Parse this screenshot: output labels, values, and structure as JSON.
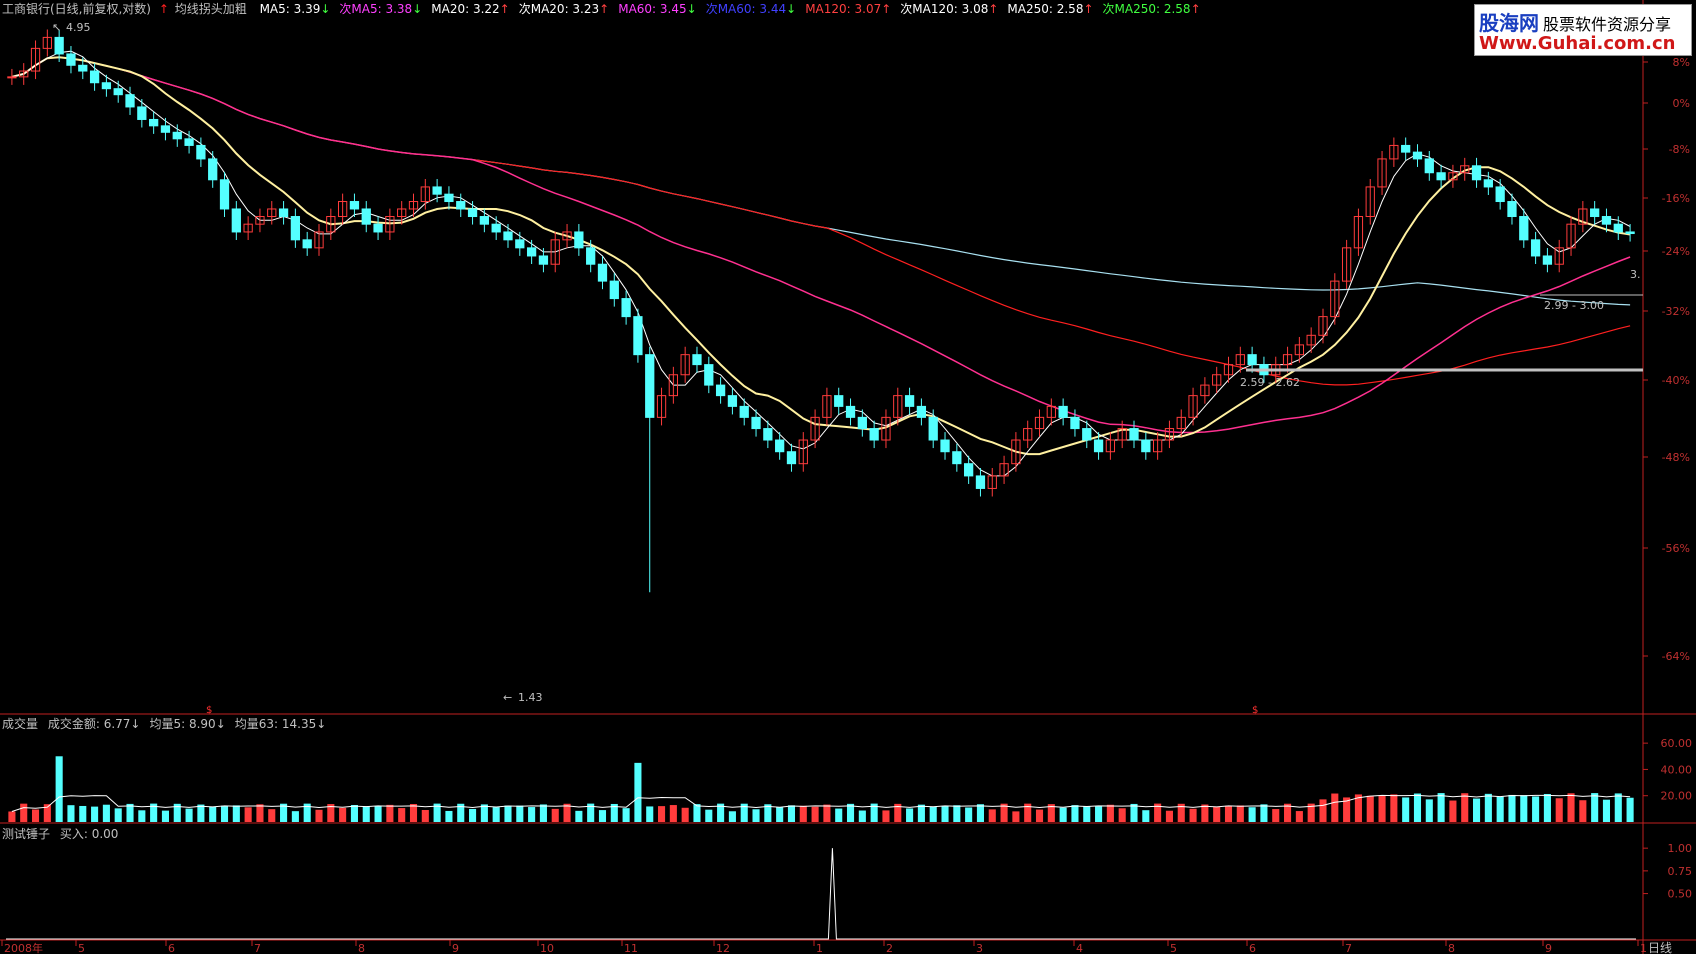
{
  "header": {
    "title": "工商银行(日线,前复权,对数)",
    "indicator_name": "均线拐头加粗",
    "ma_items": [
      {
        "label": "MA5: 3.39",
        "arrow": "↓",
        "color": "#ffffff",
        "arrow_color": "#40ff40"
      },
      {
        "label": "次MA5: 3.38",
        "arrow": "↓",
        "color": "#ff40ff",
        "arrow_color": "#40ff40"
      },
      {
        "label": "MA20: 3.22",
        "arrow": "↑",
        "color": "#ffffff",
        "arrow_color": "#ff4040"
      },
      {
        "label": "次MA20: 3.23",
        "arrow": "↑",
        "color": "#ffffff",
        "arrow_color": "#ff4040"
      },
      {
        "label": "MA60: 3.45",
        "arrow": "↓",
        "color": "#ff40ff",
        "arrow_color": "#40ff40"
      },
      {
        "label": "次MA60: 3.44",
        "arrow": "↓",
        "color": "#4040ff",
        "arrow_color": "#40ff40"
      },
      {
        "label": "MA120: 3.07",
        "arrow": "↑",
        "color": "#ff4040",
        "arrow_color": "#ff4040"
      },
      {
        "label": "次MA120: 3.08",
        "arrow": "↑",
        "color": "#ffffff",
        "arrow_color": "#ff4040"
      },
      {
        "label": "MA250: 2.58",
        "arrow": "↑",
        "color": "#ffffff",
        "arrow_color": "#ff4040"
      },
      {
        "label": "次MA250: 2.58",
        "arrow": "↑",
        "color": "#40ff40",
        "arrow_color": "#ff4040"
      }
    ]
  },
  "volume_header": {
    "name": "成交量",
    "items": [
      {
        "label": "成交金额: 6.77",
        "arrow": "↓"
      },
      {
        "label": "均量5: 8.90",
        "arrow": "↓"
      },
      {
        "label": "均量63: 14.35",
        "arrow": "↓"
      }
    ]
  },
  "signal_header": {
    "name": "测试锤子",
    "value": "买入: 0.00"
  },
  "logo": {
    "brand": "股海网",
    "slogan": "股票软件资源分享",
    "url": "Www.Guhai.com.cn"
  },
  "period_label": "日线",
  "annotations": {
    "high": "4.95",
    "low": "1.43",
    "range_a": "2.59 - 2.62",
    "range_b": "2.99 - 3.00",
    "last_price": "3."
  },
  "chart_data": [
    {
      "type": "candlestick",
      "name": "price",
      "scale": "log",
      "y_axis_ticks": [
        "8%",
        "0%",
        "-8%",
        "-16%",
        "-24%",
        "-32%",
        "-40%",
        "-48%",
        "-56%",
        "-64%"
      ],
      "x_axis_ticks": [
        "2008年",
        "5",
        "6",
        "7",
        "8",
        "9",
        "10",
        "11",
        "12",
        "1",
        "2",
        "3",
        "4",
        "5",
        "6",
        "7",
        "8",
        "9",
        "1"
      ],
      "high": 4.95,
      "low": 1.43,
      "close": [
        4.55,
        4.6,
        4.8,
        4.9,
        4.75,
        4.65,
        4.6,
        4.5,
        4.45,
        4.4,
        4.3,
        4.2,
        4.15,
        4.1,
        4.05,
        4.0,
        3.9,
        3.75,
        3.55,
        3.4,
        3.45,
        3.5,
        3.55,
        3.5,
        3.35,
        3.3,
        3.4,
        3.5,
        3.6,
        3.55,
        3.45,
        3.4,
        3.5,
        3.55,
        3.6,
        3.7,
        3.65,
        3.6,
        3.55,
        3.5,
        3.45,
        3.4,
        3.35,
        3.3,
        3.25,
        3.2,
        3.35,
        3.4,
        3.3,
        3.2,
        3.1,
        3.0,
        2.9,
        2.7,
        2.4,
        2.5,
        2.6,
        2.7,
        2.65,
        2.55,
        2.5,
        2.45,
        2.4,
        2.35,
        2.3,
        2.25,
        2.2,
        2.3,
        2.4,
        2.5,
        2.45,
        2.4,
        2.35,
        2.3,
        2.4,
        2.5,
        2.45,
        2.4,
        2.3,
        2.25,
        2.2,
        2.15,
        2.1,
        2.15,
        2.2,
        2.3,
        2.35,
        2.4,
        2.45,
        2.4,
        2.35,
        2.3,
        2.25,
        2.3,
        2.35,
        2.3,
        2.25,
        2.3,
        2.35,
        2.4,
        2.5,
        2.55,
        2.6,
        2.65,
        2.7,
        2.65,
        2.6,
        2.65,
        2.7,
        2.75,
        2.8,
        2.9,
        3.1,
        3.3,
        3.5,
        3.7,
        3.9,
        4.0,
        3.95,
        3.9,
        3.8,
        3.75,
        3.8,
        3.85,
        3.75,
        3.7,
        3.6,
        3.5,
        3.35,
        3.25,
        3.2,
        3.3,
        3.45,
        3.55,
        3.5,
        3.45,
        3.4,
        3.39
      ],
      "series": [
        {
          "name": "MA250",
          "color": "#a8e0f0"
        },
        {
          "name": "MA120",
          "color": "#ff2020"
        },
        {
          "name": "MA60",
          "color": "#ff3090"
        },
        {
          "name": "MA20",
          "color": "#fff0a0"
        },
        {
          "name": "MA5",
          "color": "#ffffff"
        }
      ]
    },
    {
      "type": "bar",
      "name": "volume",
      "y_axis_ticks": [
        "60.00",
        "40.00",
        "20.00"
      ],
      "ylim": [
        0,
        70
      ]
    },
    {
      "type": "line",
      "name": "signal",
      "y_axis_ticks": [
        "1.00",
        "0.75",
        "0.50"
      ],
      "ylim": [
        0,
        1.2
      ],
      "spike_at_fraction": 0.507
    }
  ]
}
